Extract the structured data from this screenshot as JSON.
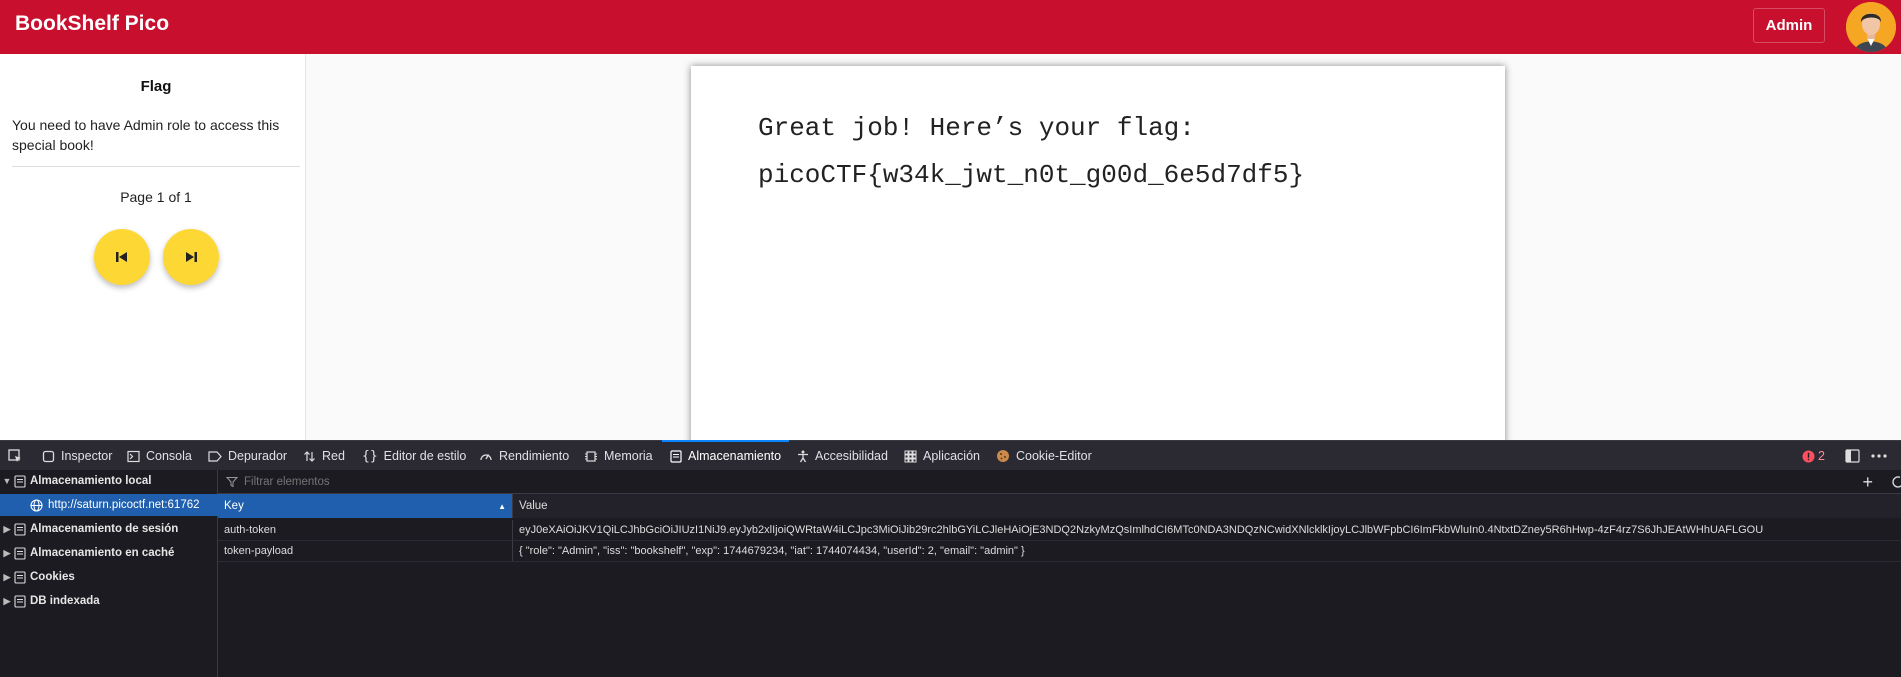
{
  "app": {
    "title": "BookShelf Pico",
    "admin_button": "Admin"
  },
  "sidebar": {
    "book_title": "Flag",
    "description": "You need to have Admin role to access this special book!",
    "page_info": "Page 1 of 1"
  },
  "page": {
    "line1": "Great job! Here’s your flag:",
    "line2": "picoCTF{w34k_jwt_n0t_g00d_6e5d7df5}"
  },
  "devtools": {
    "tabs": [
      "Inspector",
      "Consola",
      "Depurador",
      "Red",
      "Editor de estilo",
      "Rendimiento",
      "Memoria",
      "Almacenamiento",
      "Accesibilidad",
      "Aplicación",
      "Cookie-Editor"
    ],
    "active_tab": "Almacenamiento",
    "error_count": "2",
    "tree": {
      "local_storage": "Almacenamiento local",
      "origin": "http://saturn.picoctf.net:61762",
      "session_storage": "Almacenamiento de sesión",
      "cache_storage": "Almacenamiento en caché",
      "cookies": "Cookies",
      "indexed_db": "DB indexada"
    },
    "filter_placeholder": "Filtrar elementos",
    "columns": {
      "key": "Key",
      "value": "Value"
    },
    "rows": [
      {
        "key": "auth-token",
        "value": "eyJ0eXAiOiJKV1QiLCJhbGciOiJIUzI1NiJ9.eyJyb2xlIjoiQWRtaW4iLCJpc3MiOiJib29rc2hlbGYiLCJleHAiOjE3NDQ2NzkyMzQsImlhdCI6MTc0NDA3NDQzNCwidXNlcklkIjoyLCJlbWFpbCI6ImFkbWluIn0.4NtxtDZney5R6hHwp-4zF4rz7S6JhJEAtWHhUAFLGOU"
      },
      {
        "key": "token-payload",
        "value": "{ \"role\": \"Admin\", \"iss\": \"bookshelf\", \"exp\": 1744679234, \"iat\": 1744074434, \"userId\": 2, \"email\": \"admin\" }"
      }
    ]
  },
  "colors": {
    "appbar": "#c8102e",
    "nav_button": "#fdd835",
    "devtools_bg": "#1c1b22",
    "selection": "#1f5fad",
    "error": "#ff4f5e"
  }
}
